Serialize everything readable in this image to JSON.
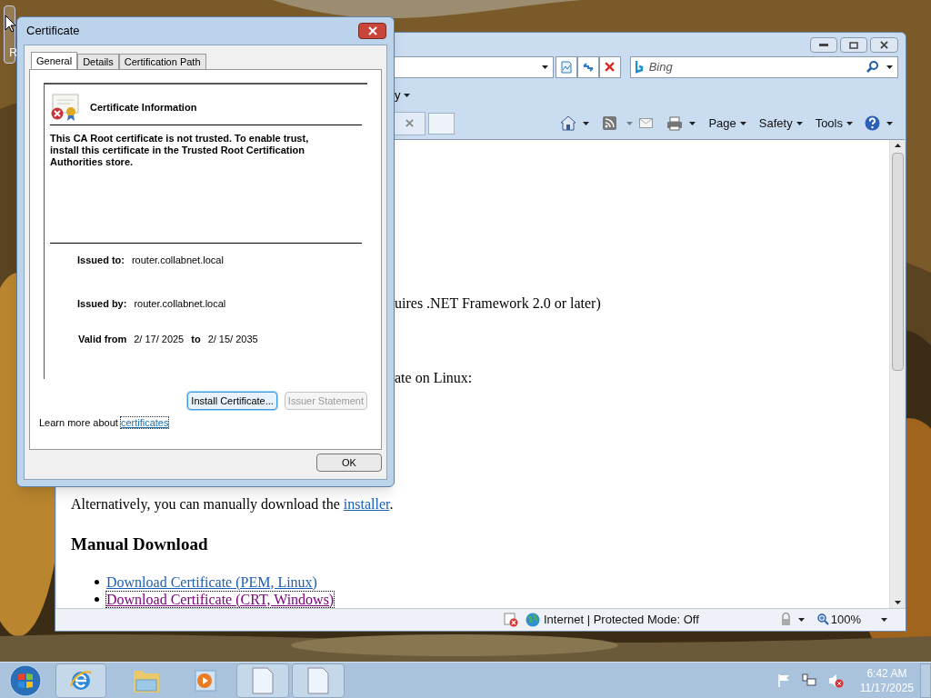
{
  "desktop": {
    "icon_label": "R"
  },
  "browser": {
    "menu_fragment": "y",
    "search": {
      "placeholder": "Bing"
    },
    "command_bar": [
      {
        "label": "Page"
      },
      {
        "label": "Safety"
      },
      {
        "label": "Tools"
      }
    ],
    "content": {
      "fragments": [
        "uires .NET Framework 2.0 or later)",
        "ate on Linux:"
      ],
      "paragraph": {
        "text": "Alternatively, you can manually download the ",
        "link": "installer",
        "after": "."
      },
      "heading": "Manual Download",
      "links": [
        {
          "text": "Download Certificate (PEM, Linux)",
          "visited": false,
          "focused": false
        },
        {
          "text": "Download Certificate (CRT, Windows)",
          "visited": true,
          "focused": true
        }
      ]
    },
    "status": {
      "zone": "Internet | Protected Mode: Off",
      "zoom": "100%"
    }
  },
  "dialog": {
    "title": "Certificate",
    "tabs": [
      {
        "label": "General",
        "selected": true
      },
      {
        "label": "Details",
        "selected": false
      },
      {
        "label": "Certification Path",
        "selected": false
      }
    ],
    "heading": "Certificate Information",
    "message": "This CA Root certificate is not trusted. To enable trust, install this certificate in the Trusted Root Certification Authorities store.",
    "fields": [
      {
        "label": "Issued to:",
        "value": "router.collabnet.local"
      },
      {
        "label": "Issued by:",
        "value": "router.collabnet.local"
      }
    ],
    "valid": {
      "label": "Valid from",
      "from": "2/ 17/ 2025",
      "to_label": "to",
      "to": "2/ 15/ 2035"
    },
    "buttons": [
      {
        "label": "Install Certificate...",
        "focused": true,
        "disabled": false
      },
      {
        "label": "Issuer Statement",
        "focused": false,
        "disabled": true
      }
    ],
    "learn_more": {
      "text": "Learn more about",
      "link": "certificates"
    },
    "ok": "OK"
  },
  "taskbar": {
    "time": "6:42 AM",
    "date": "11/17/2025"
  }
}
